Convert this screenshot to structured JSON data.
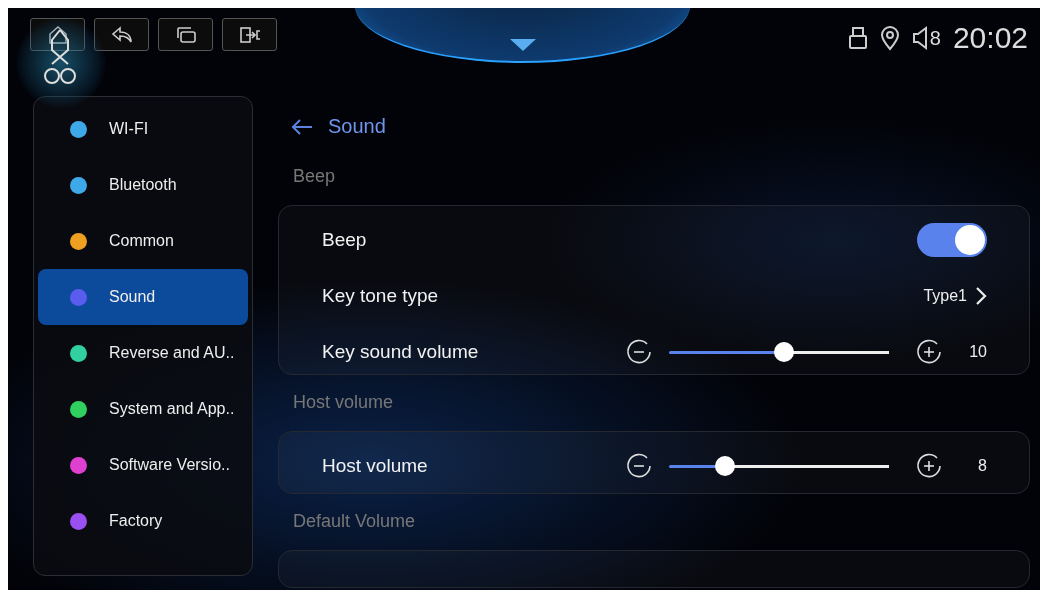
{
  "status_bar": {
    "volume": "8",
    "time": "20:02"
  },
  "sidebar": {
    "items": [
      {
        "label": "WI-FI",
        "color": "#3fa9e8",
        "selected": false
      },
      {
        "label": "Bluetooth",
        "color": "#3fa9e8",
        "selected": false
      },
      {
        "label": "Common",
        "color": "#f0a020",
        "selected": false
      },
      {
        "label": "Sound",
        "color": "#5a5cf0",
        "selected": true
      },
      {
        "label": "Reverse and AU..",
        "color": "#30d0a0",
        "selected": false
      },
      {
        "label": "System and App..",
        "color": "#30d060",
        "selected": false
      },
      {
        "label": "Software Versio..",
        "color": "#e040d0",
        "selected": false
      },
      {
        "label": "Factory",
        "color": "#9a50f0",
        "selected": false
      }
    ]
  },
  "page": {
    "title": "Sound"
  },
  "sections": [
    {
      "title": "Beep",
      "rows": [
        {
          "kind": "toggle",
          "label": "Beep",
          "on": true
        },
        {
          "kind": "select",
          "label": "Key tone type",
          "value": "Type1"
        },
        {
          "kind": "slider",
          "label": "Key sound volume",
          "level": 0.5,
          "reading": "10"
        }
      ]
    },
    {
      "title": "Host volume",
      "rows": [
        {
          "kind": "slider",
          "label": "Host volume",
          "level": 0.22,
          "reading": "8"
        }
      ]
    },
    {
      "title": "Default Volume"
    }
  ]
}
